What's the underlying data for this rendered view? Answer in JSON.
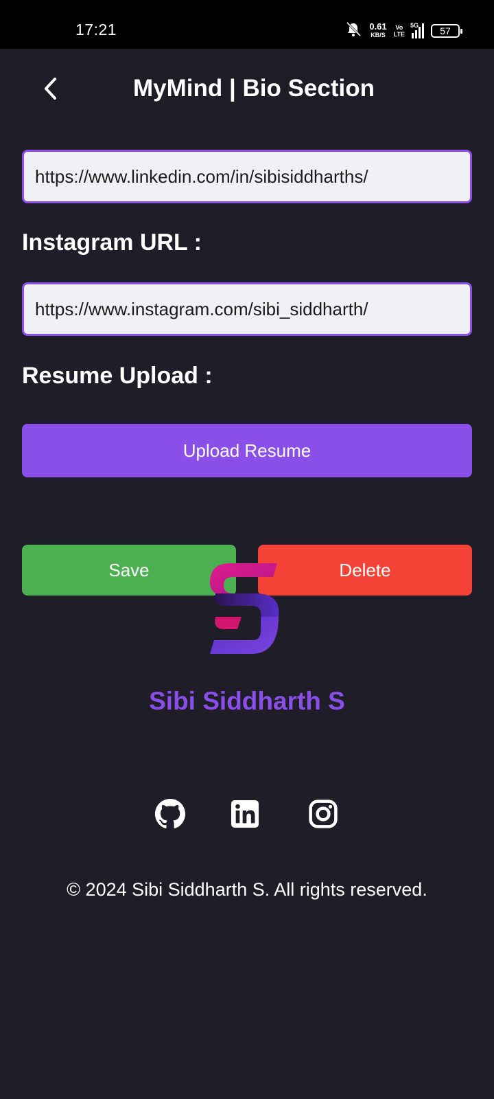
{
  "status_bar": {
    "time": "17:21",
    "speed_value": "0.61",
    "speed_unit": "KB/S",
    "volte_top": "Vo",
    "volte_bottom": "LTE",
    "network": "5G",
    "battery": "57"
  },
  "header": {
    "title": "MyMind | Bio Section"
  },
  "form": {
    "linkedin_value": "https://www.linkedin.com/in/sibisiddharths/",
    "instagram_label": "Instagram URL :",
    "instagram_value": "https://www.instagram.com/sibi_siddharth/",
    "resume_label": "Resume Upload :",
    "upload_label": "Upload Resume",
    "save_label": "Save",
    "delete_label": "Delete"
  },
  "branding": {
    "author_name": "Sibi Siddharth S"
  },
  "social": [
    "github-icon",
    "linkedin-icon",
    "instagram-icon"
  ],
  "footer": {
    "copyright": "© 2024 Sibi Siddharth S. All rights reserved."
  },
  "colors": {
    "background": "#1e1d28",
    "accent": "#8a4fe8",
    "save": "#4caf50",
    "delete": "#f44336",
    "input_bg": "#f1f1f5"
  }
}
